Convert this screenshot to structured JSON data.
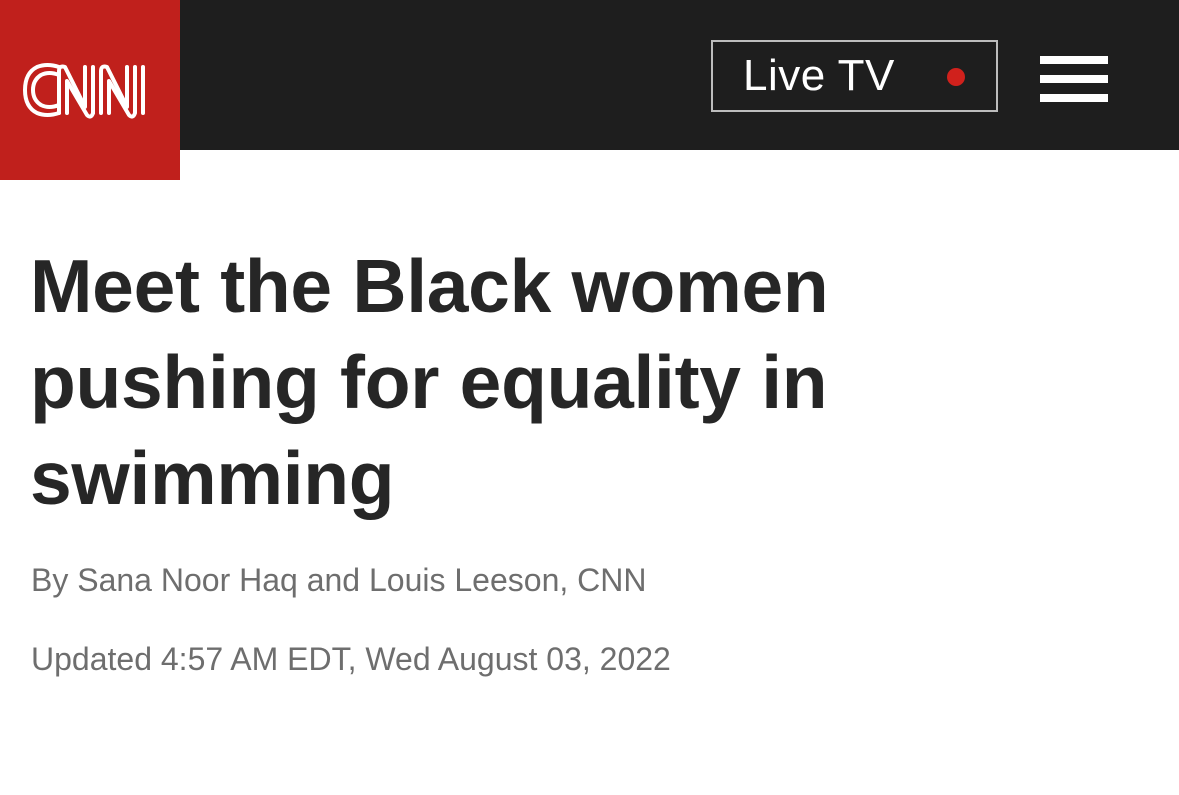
{
  "header": {
    "logo_text": "CNN",
    "logo_icon": "cnn-logo",
    "live_tv_label": "Live TV",
    "menu_icon": "hamburger-menu-icon"
  },
  "article": {
    "headline": "Meet the Black women pushing for equality in swimming",
    "byline": "By Sana Noor Haq and Louis Leeson, CNN",
    "updated": "Updated 4:57 AM EDT, Wed August 03, 2022"
  },
  "colors": {
    "brand_red": "#c0201c",
    "header_bg": "#1e1e1e",
    "live_dot": "#d0211c",
    "headline_text": "#262626",
    "meta_text": "#6e6e6e"
  }
}
